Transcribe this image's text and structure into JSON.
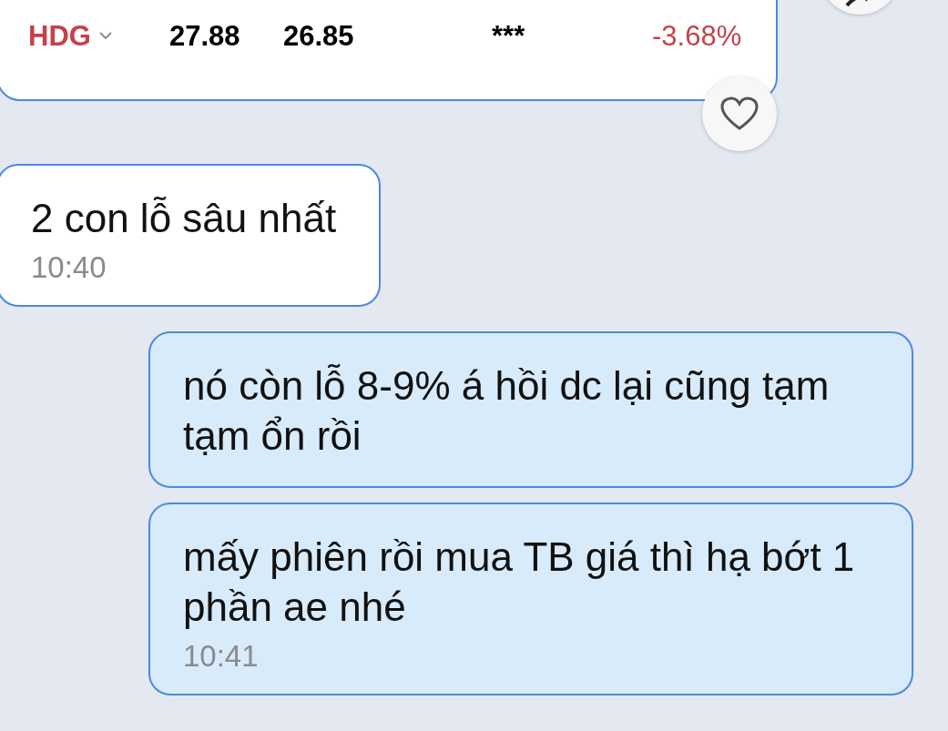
{
  "stock_card": {
    "row": {
      "ticker": "HDG",
      "column_2": "27.88",
      "column_3": "26.85",
      "column_4": "***",
      "change": "-3.68%",
      "kind": "down"
    }
  },
  "messages": [
    {
      "kind": "received",
      "text": "2 con lỗ sâu nhất",
      "time": "10:40"
    },
    {
      "kind": "sent",
      "text": "nó còn lỗ 8-9% á hồi dc lại cũng tạm tạm ổn rồi"
    },
    {
      "kind": "sent",
      "text": "mấy phiên rồi mua TB giá thì hạ bớt 1 phần ae nhé",
      "time": "10:41"
    }
  ]
}
